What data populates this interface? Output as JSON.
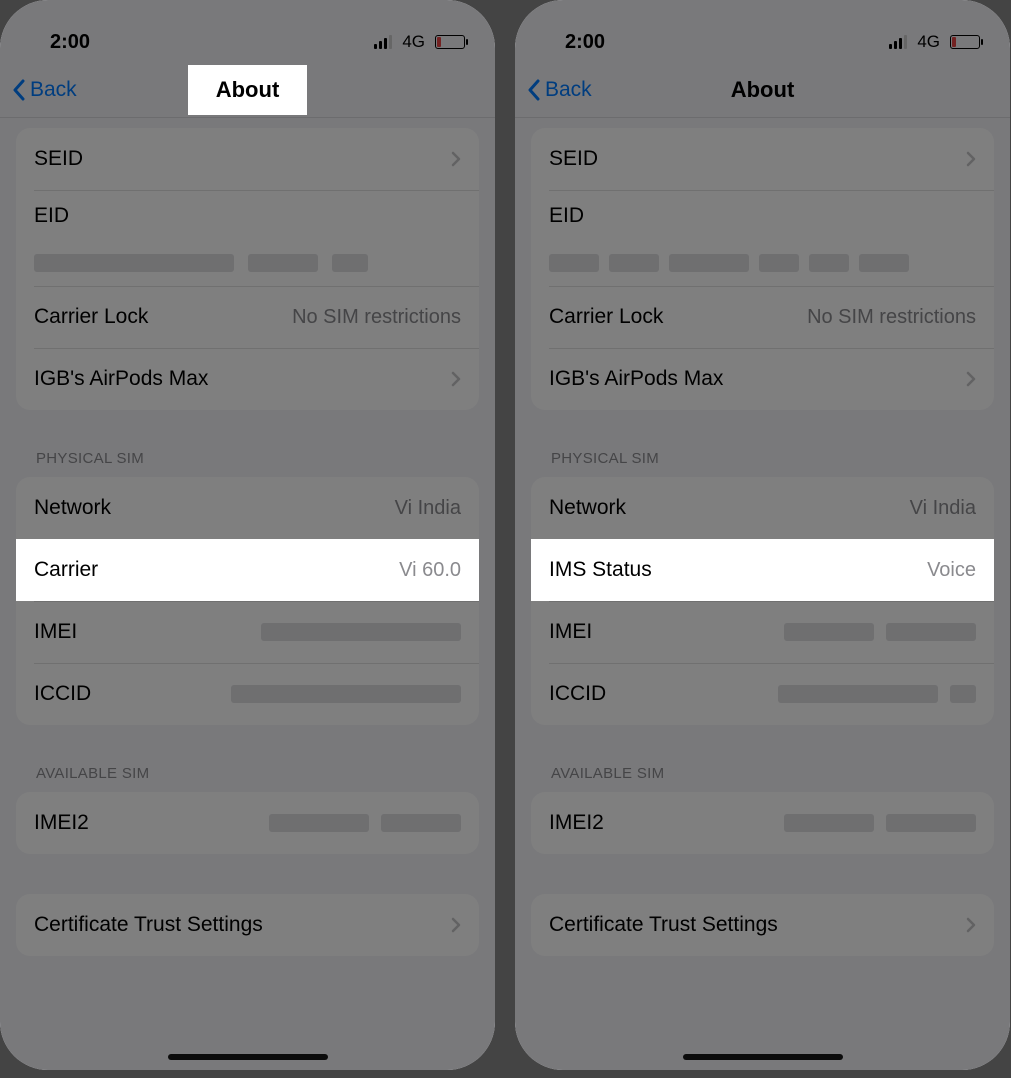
{
  "statusbar": {
    "time": "2:00",
    "network": "4G"
  },
  "nav": {
    "back": "Back",
    "title": "About"
  },
  "group1": {
    "seid": "SEID",
    "eid": "EID",
    "carrier_lock_label": "Carrier Lock",
    "carrier_lock_value": "No SIM restrictions",
    "airpods": "IGB's AirPods Max"
  },
  "physical": {
    "header": "Physical SIM",
    "network_label": "Network",
    "network_value": "Vi India",
    "carrier_label": "Carrier",
    "carrier_value": "Vi 60.0",
    "ims_label": "IMS Status",
    "ims_value": "Voice",
    "imei_label": "IMEI",
    "iccid_label": "ICCID"
  },
  "available": {
    "header": "Available SIM",
    "imei2_label": "IMEI2"
  },
  "cert": {
    "label": "Certificate Trust Settings"
  }
}
